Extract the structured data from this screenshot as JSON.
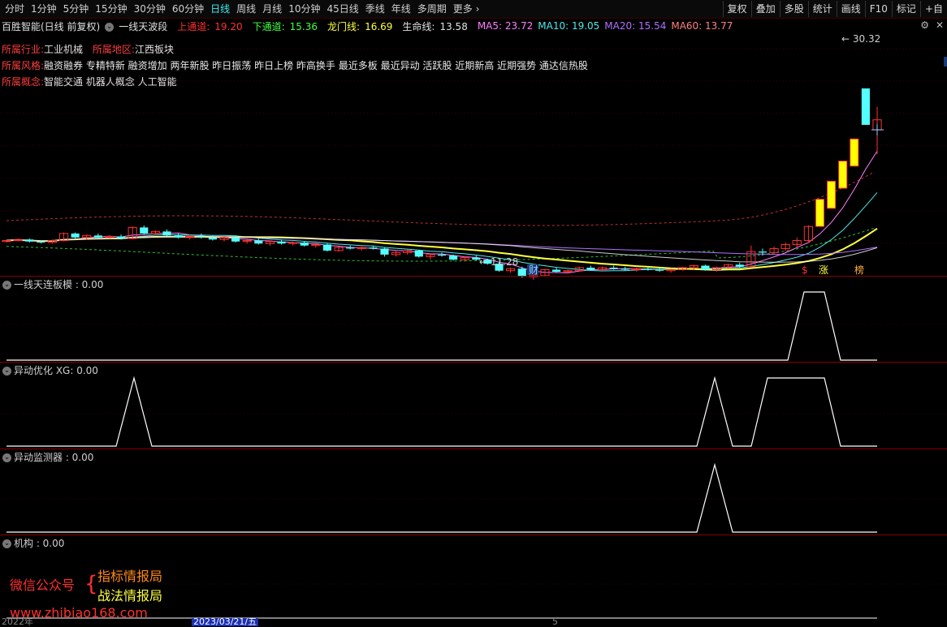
{
  "toolbar": {
    "periods": [
      "分时",
      "1分钟",
      "5分钟",
      "15分钟",
      "30分钟",
      "60分钟",
      "日线",
      "周线",
      "月线",
      "10分钟",
      "45日线",
      "季线",
      "年线",
      "多周期",
      "更多"
    ],
    "active_period": "日线",
    "tools": [
      "复权",
      "叠加",
      "多股",
      "统计",
      "画线",
      "F10",
      "标记",
      "+自"
    ]
  },
  "info": {
    "title": "百胜智能(日线 前复权)",
    "indicator": "一线天波段",
    "upper_label": "上通道:",
    "upper": "19.20",
    "lower_label": "下通道:",
    "lower": "15.36",
    "dragon_label": "龙门线:",
    "dragon": "16.69",
    "life_label": "生命线:",
    "life": "13.58",
    "ma5": "MA5: 23.72",
    "ma10": "MA10: 19.05",
    "ma20": "MA20: 15.54",
    "ma60": "MA60: 13.77"
  },
  "tags": [
    {
      "label": "所属行业:",
      "value": "工业机械",
      "label2": "所属地区:",
      "value2": "江西板块"
    },
    {
      "label": "所属风格:",
      "value": "融资融券 专精特新 融资增加 两年新股 昨日振荡 昨日上榜 昨高换手 最近多板 最近异动 活跃股 近期新高 近期强势 通达信热股"
    },
    {
      "label": "所属概念:",
      "value": "智能交通 机器人概念 人工智能"
    }
  ],
  "price_marks": {
    "high": "30.32",
    "low": "11.28"
  },
  "event_marks": {
    "cai": "财",
    "s": "$",
    "zhang": "涨",
    "bang": "榜"
  },
  "panels": [
    {
      "label": "一线天连板模 : 0.00"
    },
    {
      "label": "异动优化 XG: 0.00"
    },
    {
      "label": "异动监测器 : 0.00"
    },
    {
      "label": "机构 : 0.00"
    }
  ],
  "watermark": {
    "line1": "微信公众号",
    "line2a": "指标情报局",
    "line2b": "战法情报局",
    "url": "www.zhibiao168.com"
  },
  "dates": {
    "left": "2022年",
    "mid": "2023/03/21/五",
    "right": "5"
  },
  "colors": {
    "up": "#ff3030",
    "down": "#54ffff",
    "limit": "#ffff00",
    "ma5": "#ff7fff",
    "ma10": "#50e8e8",
    "ma20": "#ffff40",
    "ma60": "#b070ff"
  },
  "chart_data": {
    "type": "candlestick",
    "candles": [
      [
        15.1,
        15.3,
        15.0,
        15.2
      ],
      [
        15.2,
        15.4,
        15.1,
        15.3
      ],
      [
        15.3,
        15.4,
        15.0,
        15.1
      ],
      [
        15.1,
        15.2,
        14.9,
        15.0
      ],
      [
        15.0,
        15.3,
        14.9,
        15.2
      ],
      [
        15.2,
        16.0,
        15.1,
        15.9
      ],
      [
        15.9,
        16.0,
        15.4,
        15.5
      ],
      [
        15.5,
        15.8,
        15.3,
        15.7
      ],
      [
        15.7,
        15.9,
        15.4,
        15.5
      ],
      [
        15.5,
        15.7,
        15.4,
        15.6
      ],
      [
        15.6,
        15.8,
        15.3,
        15.4
      ],
      [
        15.4,
        16.6,
        15.3,
        16.5
      ],
      [
        16.5,
        16.7,
        15.8,
        15.9
      ],
      [
        15.9,
        16.2,
        15.7,
        16.1
      ],
      [
        16.1,
        16.3,
        15.6,
        15.7
      ],
      [
        15.7,
        15.9,
        15.4,
        15.5
      ],
      [
        15.5,
        15.8,
        15.3,
        15.6
      ],
      [
        15.6,
        15.9,
        15.4,
        15.5
      ],
      [
        15.5,
        15.7,
        15.2,
        15.3
      ],
      [
        15.3,
        15.6,
        15.1,
        15.5
      ],
      [
        15.5,
        15.7,
        15.0,
        15.1
      ],
      [
        15.1,
        15.3,
        14.9,
        15.2
      ],
      [
        15.2,
        15.4,
        14.8,
        14.9
      ],
      [
        14.9,
        15.2,
        14.7,
        15.1
      ],
      [
        15.1,
        15.3,
        14.8,
        14.9
      ],
      [
        14.9,
        15.1,
        14.7,
        15.0
      ],
      [
        15.0,
        15.1,
        14.6,
        14.7
      ],
      [
        14.7,
        14.9,
        14.5,
        14.8
      ],
      [
        14.8,
        14.9,
        14.1,
        14.2
      ],
      [
        14.2,
        14.6,
        14.1,
        14.5
      ],
      [
        14.5,
        14.7,
        14.3,
        14.4
      ],
      [
        14.4,
        14.6,
        14.2,
        14.5
      ],
      [
        14.5,
        14.7,
        14.3,
        14.4
      ],
      [
        14.4,
        14.5,
        13.6,
        13.8
      ],
      [
        13.8,
        14.2,
        13.6,
        14.0
      ],
      [
        14.0,
        14.3,
        13.8,
        14.2
      ],
      [
        14.2,
        14.3,
        13.5,
        13.6
      ],
      [
        13.6,
        13.9,
        13.3,
        13.8
      ],
      [
        13.8,
        14.0,
        13.6,
        13.7
      ],
      [
        13.7,
        13.8,
        13.2,
        13.3
      ],
      [
        13.3,
        13.6,
        13.1,
        13.5
      ],
      [
        13.5,
        13.7,
        13.2,
        13.3
      ],
      [
        13.3,
        13.4,
        12.8,
        12.9
      ],
      [
        12.9,
        13.1,
        12.1,
        12.2
      ],
      [
        12.2,
        12.5,
        12.0,
        12.4
      ],
      [
        12.4,
        12.6,
        11.5,
        11.6
      ],
      [
        11.6,
        11.8,
        11.28,
        11.7
      ],
      [
        11.7,
        12.4,
        11.6,
        12.3
      ],
      [
        12.3,
        12.5,
        12.0,
        12.1
      ],
      [
        12.1,
        12.3,
        11.9,
        12.2
      ],
      [
        12.2,
        12.6,
        12.1,
        12.5
      ],
      [
        12.5,
        12.7,
        12.2,
        12.3
      ],
      [
        12.3,
        12.6,
        12.1,
        12.5
      ],
      [
        12.5,
        12.7,
        12.3,
        12.4
      ],
      [
        12.4,
        12.6,
        12.2,
        12.3
      ],
      [
        12.3,
        12.5,
        12.1,
        12.4
      ],
      [
        12.4,
        12.6,
        12.2,
        12.3
      ],
      [
        12.3,
        12.5,
        12.1,
        12.2
      ],
      [
        12.2,
        12.4,
        12.0,
        12.3
      ],
      [
        12.3,
        12.6,
        12.2,
        12.5
      ],
      [
        12.5,
        12.8,
        12.3,
        12.7
      ],
      [
        12.7,
        12.8,
        12.2,
        12.3
      ],
      [
        12.3,
        12.6,
        12.1,
        12.5
      ],
      [
        12.5,
        12.9,
        12.4,
        12.8
      ],
      [
        12.8,
        13.0,
        12.5,
        12.6
      ],
      [
        12.6,
        14.7,
        12.6,
        14.1
      ],
      [
        14.1,
        14.4,
        13.7,
        14.0
      ],
      [
        14.0,
        14.6,
        13.9,
        14.4
      ],
      [
        14.4,
        15.0,
        14.2,
        14.8
      ],
      [
        14.8,
        15.5,
        14.5,
        15.2
      ],
      [
        15.2,
        16.7,
        15.0,
        16.6
      ],
      [
        18.3,
        18.3,
        18.3,
        18.3
      ],
      [
        20.1,
        20.1,
        20.1,
        20.1
      ],
      [
        22.1,
        22.1,
        22.1,
        22.1
      ],
      [
        24.3,
        24.6,
        24.3,
        24.3
      ],
      [
        30.32,
        30.32,
        26.7,
        26.7
      ],
      [
        26.2,
        28.5,
        23.8,
        27.2
      ]
    ]
  }
}
